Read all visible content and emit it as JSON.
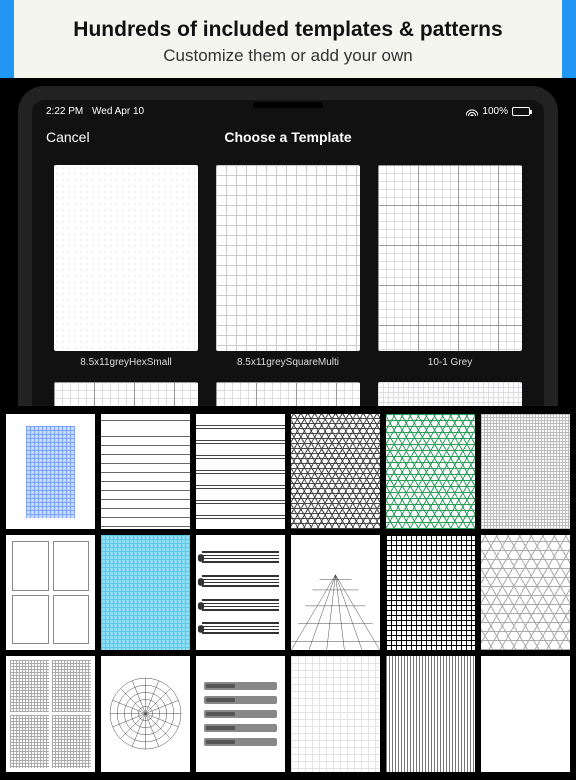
{
  "promo": {
    "title": "Hundreds of included templates & patterns",
    "subtitle": "Customize them or add your own"
  },
  "statusbar": {
    "time": "2:22 PM",
    "date": "Wed Apr 10",
    "battery_pct": "100%"
  },
  "navbar": {
    "cancel": "Cancel",
    "title": "Choose a Template"
  },
  "templates": [
    {
      "label": "8.5x11greyHexSmall"
    },
    {
      "label": "8.5x11greySquareMulti"
    },
    {
      "label": "10-1 Grey"
    },
    {
      "label": ""
    },
    {
      "label": ""
    },
    {
      "label": ""
    }
  ],
  "gallery_items": [
    "blue-grid-narrow",
    "lined-paper",
    "double-lined",
    "triangle-hatch-dark",
    "green-hex",
    "fine-grey-grid",
    "storyboard-4up",
    "cyan-grid",
    "music-staves",
    "perspective-grid",
    "dense-black-grid",
    "hex-large",
    "multi-grid-4up",
    "polar-chart",
    "bar-template",
    "light-grid",
    "vertical-stripes",
    "blank"
  ]
}
